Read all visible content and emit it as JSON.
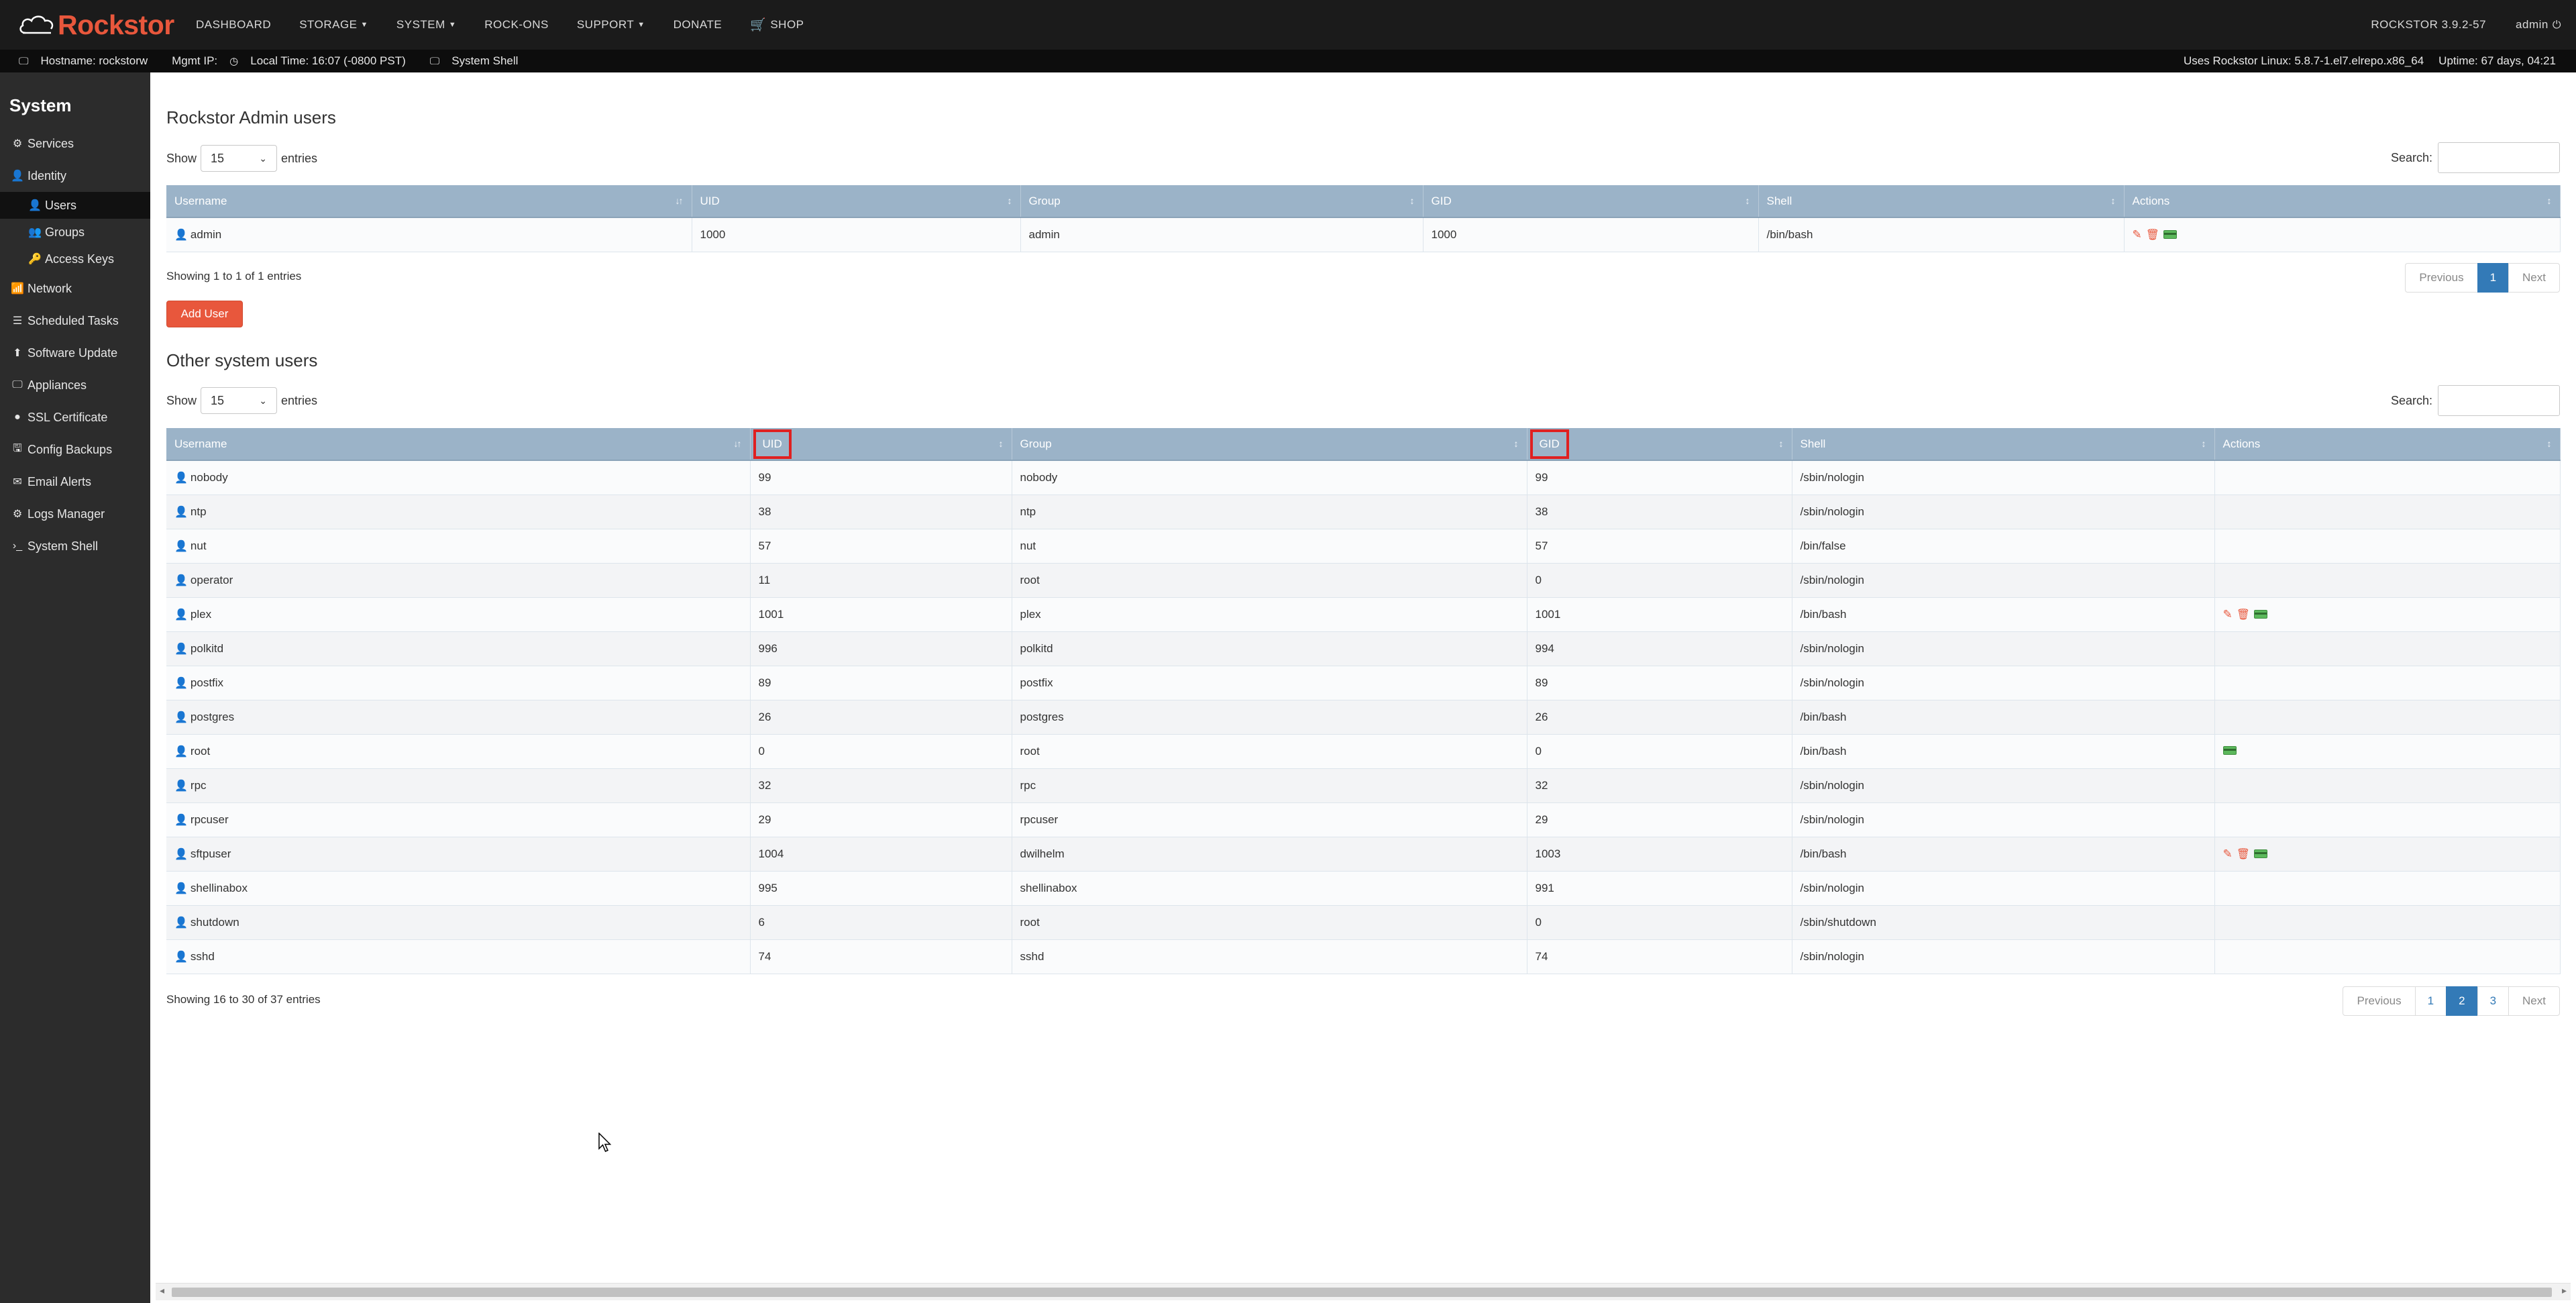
{
  "brand": {
    "name": "Rockstor"
  },
  "nav": {
    "items": [
      {
        "label": "DASHBOARD",
        "caret": false
      },
      {
        "label": "STORAGE",
        "caret": true
      },
      {
        "label": "SYSTEM",
        "caret": true
      },
      {
        "label": "ROCK-ONS",
        "caret": false
      },
      {
        "label": "SUPPORT",
        "caret": true
      },
      {
        "label": "DONATE",
        "caret": false
      },
      {
        "label": "SHOP",
        "caret": false
      }
    ],
    "version": "ROCKSTOR 3.9.2-57",
    "user": "admin"
  },
  "infobar": {
    "hostname": "Hostname: rockstorw",
    "mgmt_ip": "Mgmt IP:",
    "local_time": "Local Time: 16:07 (-0800 PST)",
    "system_shell": "System Shell",
    "kernel": "Uses Rockstor Linux: 5.8.7-1.el7.elrepo.x86_64",
    "uptime": "Uptime: 67 days, 04:21"
  },
  "sidebar": {
    "title": "System",
    "items": [
      {
        "label": "Services",
        "icon": "gear-icon"
      },
      {
        "label": "Identity",
        "icon": "user-icon"
      },
      {
        "label": "Users",
        "icon": "user-icon"
      },
      {
        "label": "Groups",
        "icon": "group-icon"
      },
      {
        "label": "Access Keys",
        "icon": "key-icon"
      },
      {
        "label": "Network",
        "icon": "signal-icon"
      },
      {
        "label": "Scheduled Tasks",
        "icon": "tasks-icon"
      },
      {
        "label": "Software Update",
        "icon": "arrow-up-icon"
      },
      {
        "label": "Appliances",
        "icon": "monitor-icon"
      },
      {
        "label": "SSL Certificate",
        "icon": "circle-icon"
      },
      {
        "label": "Config Backups",
        "icon": "backup-icon"
      },
      {
        "label": "Email Alerts",
        "icon": "envelope-icon"
      },
      {
        "label": "Logs Manager",
        "icon": "cogs-icon"
      },
      {
        "label": "System Shell",
        "icon": "terminal-icon"
      }
    ]
  },
  "admin_section": {
    "title": "Rockstor Admin users",
    "show_label": "Show",
    "entries_value": "15",
    "entries_label": "entries",
    "search_label": "Search:",
    "headers": [
      "Username",
      "UID",
      "Group",
      "GID",
      "Shell",
      "Actions"
    ],
    "rows": [
      {
        "username": "admin",
        "uid": "1000",
        "group": "admin",
        "gid": "1000",
        "shell": "/bin/bash",
        "actions": [
          "edit",
          "delete",
          "card"
        ]
      }
    ],
    "info": "Showing 1 to 1 of 1 entries",
    "pager": [
      "Previous",
      "1",
      "Next"
    ],
    "add_button": "Add User"
  },
  "other_section": {
    "title": "Other system users",
    "show_label": "Show",
    "entries_value": "15",
    "entries_label": "entries",
    "search_label": "Search:",
    "headers": [
      "Username",
      "UID",
      "Group",
      "GID",
      "Shell",
      "Actions"
    ],
    "rows": [
      {
        "username": "nobody",
        "uid": "99",
        "group": "nobody",
        "gid": "99",
        "shell": "/sbin/nologin",
        "actions": []
      },
      {
        "username": "ntp",
        "uid": "38",
        "group": "ntp",
        "gid": "38",
        "shell": "/sbin/nologin",
        "actions": []
      },
      {
        "username": "nut",
        "uid": "57",
        "group": "nut",
        "gid": "57",
        "shell": "/bin/false",
        "actions": []
      },
      {
        "username": "operator",
        "uid": "11",
        "group": "root",
        "gid": "0",
        "shell": "/sbin/nologin",
        "actions": []
      },
      {
        "username": "plex",
        "uid": "1001",
        "group": "plex",
        "gid": "1001",
        "shell": "/bin/bash",
        "actions": [
          "edit",
          "delete",
          "card"
        ]
      },
      {
        "username": "polkitd",
        "uid": "996",
        "group": "polkitd",
        "gid": "994",
        "shell": "/sbin/nologin",
        "actions": []
      },
      {
        "username": "postfix",
        "uid": "89",
        "group": "postfix",
        "gid": "89",
        "shell": "/sbin/nologin",
        "actions": []
      },
      {
        "username": "postgres",
        "uid": "26",
        "group": "postgres",
        "gid": "26",
        "shell": "/bin/bash",
        "actions": []
      },
      {
        "username": "root",
        "uid": "0",
        "group": "root",
        "gid": "0",
        "shell": "/bin/bash",
        "actions": [
          "card"
        ]
      },
      {
        "username": "rpc",
        "uid": "32",
        "group": "rpc",
        "gid": "32",
        "shell": "/sbin/nologin",
        "actions": []
      },
      {
        "username": "rpcuser",
        "uid": "29",
        "group": "rpcuser",
        "gid": "29",
        "shell": "/sbin/nologin",
        "actions": []
      },
      {
        "username": "sftpuser",
        "uid": "1004",
        "group": "dwilhelm",
        "gid": "1003",
        "shell": "/bin/bash",
        "actions": [
          "edit",
          "delete",
          "card"
        ]
      },
      {
        "username": "shellinabox",
        "uid": "995",
        "group": "shellinabox",
        "gid": "991",
        "shell": "/sbin/nologin",
        "actions": []
      },
      {
        "username": "shutdown",
        "uid": "6",
        "group": "root",
        "gid": "0",
        "shell": "/sbin/shutdown",
        "actions": []
      },
      {
        "username": "sshd",
        "uid": "74",
        "group": "sshd",
        "gid": "74",
        "shell": "/sbin/nologin",
        "actions": []
      }
    ],
    "info": "Showing 16 to 30 of 37 entries",
    "pager": [
      "Previous",
      "1",
      "2",
      "3",
      "Next"
    ],
    "pager_active": "2"
  },
  "colors": {
    "brand": "#e8573c",
    "header_bg": "#9bb3c8",
    "highlight": "#e02020",
    "pager_active": "#337ab7"
  }
}
